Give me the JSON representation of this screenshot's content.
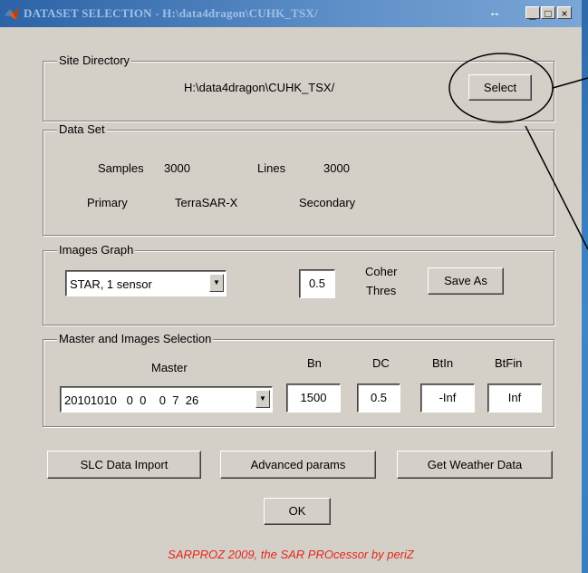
{
  "window": {
    "title": "DATASET SELECTION - H:\\data4dragon\\CUHK_TSX/",
    "dock_symbol": "↔",
    "min_symbol": "_",
    "max_symbol": "□",
    "close_symbol": "×"
  },
  "site_directory": {
    "legend": "Site Directory",
    "path": "H:\\data4dragon\\CUHK_TSX/",
    "select_label": "Select"
  },
  "data_set": {
    "legend": "Data Set",
    "samples_label": "Samples",
    "samples_value": "3000",
    "lines_label": "Lines",
    "lines_value": "3000",
    "primary_label": "Primary",
    "primary_value": "TerraSAR-X",
    "secondary_label": "Secondary"
  },
  "images_graph": {
    "legend": "Images Graph",
    "graph_type": "STAR, 1 sensor",
    "coher_value": "0.5",
    "coher_label_1": "Coher",
    "coher_label_2": "Thres",
    "save_as_label": "Save As"
  },
  "master_selection": {
    "legend": "Master and Images Selection",
    "master_label": "Master",
    "master_value": "20101010   0  0    0  7  26",
    "bn_label": "Bn",
    "bn_value": "1500",
    "dc_label": "DC",
    "dc_value": "0.5",
    "btin_label": "BtIn",
    "btin_value": "-Inf",
    "btfin_label": "BtFin",
    "btfin_value": "Inf"
  },
  "buttons": {
    "slc_import": "SLC Data Import",
    "advanced": "Advanced params",
    "weather": "Get Weather Data",
    "ok": "OK"
  },
  "footer": "SARPROZ  2009, the SAR PROcessor by periZ",
  "colors": {
    "window_bg": "#d4d0c8",
    "footer_text": "#e4261d",
    "title_text": "#9fc0e8",
    "desktop": "#3a78b8"
  }
}
